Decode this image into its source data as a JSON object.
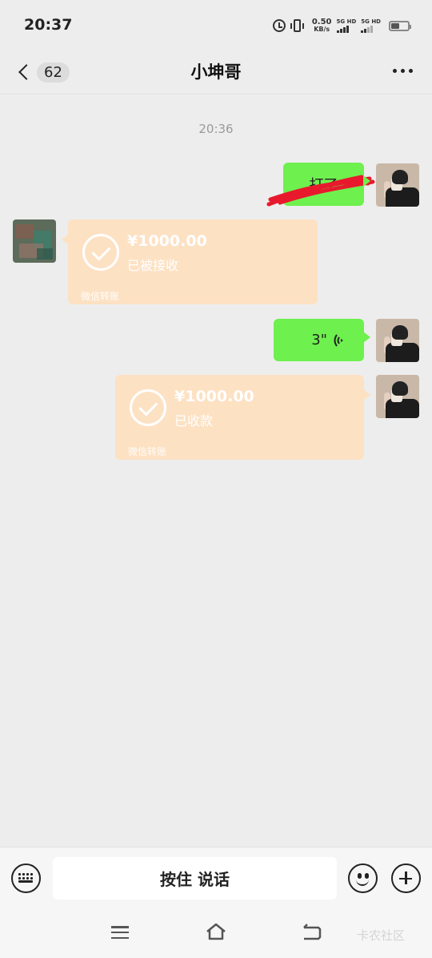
{
  "status_bar": {
    "time": "20:37",
    "net_speed_value": "0.50",
    "net_speed_unit": "KB/s",
    "sim1_label": "5G HD",
    "sim2_label": "5G HD"
  },
  "header": {
    "unread_count": "62",
    "title": "小坤哥"
  },
  "messages": {
    "timestamp": "20:36",
    "text_message": "打了",
    "transfer_received": {
      "amount": "¥1000.00",
      "status": "已被接收",
      "footer": "微信转账"
    },
    "voice": {
      "duration": "3\""
    },
    "transfer_collected": {
      "amount": "¥1000.00",
      "status": "已收款",
      "footer": "微信转账"
    }
  },
  "input_bar": {
    "hold_to_talk": "按住 说话"
  },
  "watermark": "卡农社区",
  "colors": {
    "background": "#ededed",
    "my_bubble": "#6ef04e",
    "transfer_bubble": "#fde1c3"
  }
}
